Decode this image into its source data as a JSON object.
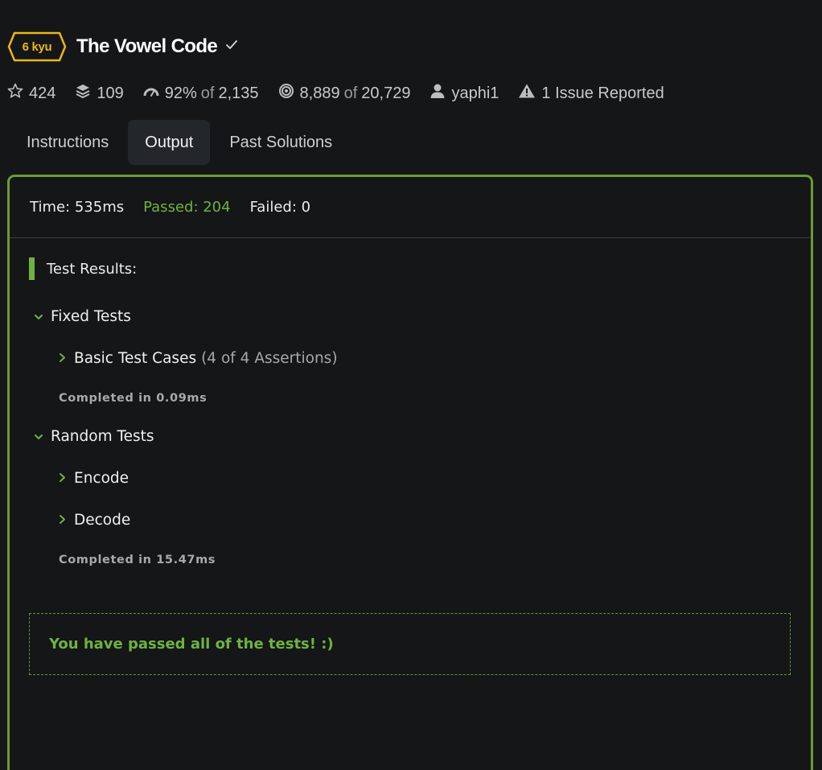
{
  "kata": {
    "rank": "6 kyu",
    "title": "The Vowel Code",
    "rank_color": "#ecb613"
  },
  "stats": {
    "stars": "424",
    "collections": "109",
    "satisfaction": "92%",
    "satisfaction_of": "of",
    "satisfaction_votes": "2,135",
    "completed": "8,889",
    "completed_of": "of",
    "attempts": "20,729",
    "author": "yaphi1",
    "issues": "1 Issue Reported"
  },
  "tabs": [
    {
      "label": "Instructions",
      "active": false
    },
    {
      "label": "Output",
      "active": true
    },
    {
      "label": "Past Solutions",
      "active": false
    }
  ],
  "output": {
    "time": "Time: 535ms",
    "passed": "Passed: 204",
    "failed": "Failed: 0",
    "results_title": "Test Results:",
    "groups": [
      {
        "name": "Fixed Tests",
        "items": [
          {
            "name": "Basic Test Cases",
            "assertions": "(4 of 4 Assertions)"
          }
        ],
        "completed": "Completed in 0.09ms"
      },
      {
        "name": "Random Tests",
        "items": [
          {
            "name": "Encode"
          },
          {
            "name": "Decode"
          }
        ],
        "completed": "Completed in 15.47ms"
      }
    ],
    "pass_message": "You have passed all of the tests! :)"
  },
  "colors": {
    "background": "#141617",
    "accent_green": "#6fb33f",
    "panel_border": "#6b9a34"
  }
}
